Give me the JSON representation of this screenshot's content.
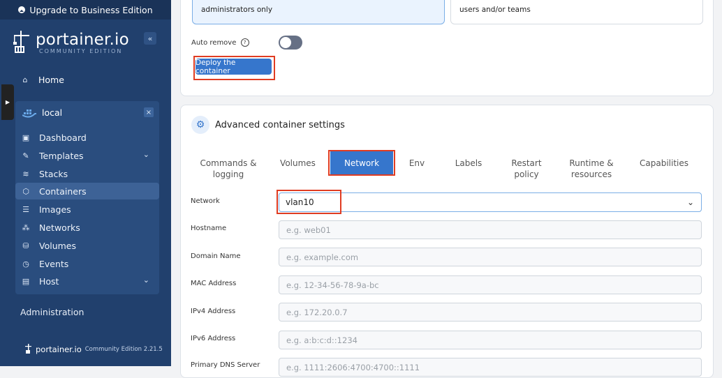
{
  "sidebar": {
    "upgrade_label": "Upgrade to Business Edition",
    "logo_text": "portainer.io",
    "logo_subtitle": "COMMUNITY EDITION",
    "collapse_label": "«",
    "home_label": "Home",
    "environment": {
      "name": "local",
      "close_label": "×",
      "items": [
        {
          "label": "Dashboard",
          "icon": "dashboard-icon"
        },
        {
          "label": "Templates",
          "icon": "templates-icon",
          "expandable": true
        },
        {
          "label": "Stacks",
          "icon": "stacks-icon"
        },
        {
          "label": "Containers",
          "icon": "containers-icon",
          "active": true
        },
        {
          "label": "Images",
          "icon": "images-icon"
        },
        {
          "label": "Networks",
          "icon": "networks-icon"
        },
        {
          "label": "Volumes",
          "icon": "volumes-icon"
        },
        {
          "label": "Events",
          "icon": "events-icon"
        },
        {
          "label": "Host",
          "icon": "host-icon",
          "expandable": true
        }
      ]
    },
    "administration_label": "Administration",
    "footer": {
      "brand": "portainer.io",
      "edition": "Community Edition 2.21.5"
    }
  },
  "access": {
    "admins_text": "administrators only",
    "teams_text": "users and/or teams"
  },
  "auto_remove": {
    "label": "Auto remove",
    "help_icon": "?",
    "enabled": false
  },
  "deploy_button_label": "Deploy the container",
  "advanced": {
    "title": "Advanced container settings",
    "tabs": [
      {
        "label": "Commands & logging"
      },
      {
        "label": "Volumes"
      },
      {
        "label": "Network",
        "active": true
      },
      {
        "label": "Env"
      },
      {
        "label": "Labels"
      },
      {
        "label": "Restart policy"
      },
      {
        "label": "Runtime & resources"
      },
      {
        "label": "Capabilities"
      }
    ],
    "fields": {
      "network": {
        "label": "Network",
        "value": "vlan10"
      },
      "hostname": {
        "label": "Hostname",
        "placeholder": "e.g. web01"
      },
      "domain": {
        "label": "Domain Name",
        "placeholder": "e.g. example.com"
      },
      "mac": {
        "label": "MAC Address",
        "placeholder": "e.g. 12-34-56-78-9a-bc"
      },
      "ipv4": {
        "label": "IPv4 Address",
        "placeholder": "e.g. 172.20.0.7"
      },
      "ipv6": {
        "label": "IPv6 Address",
        "placeholder": "e.g. a:b:c:d::1234"
      },
      "dns": {
        "label": "Primary DNS Server",
        "placeholder": "e.g. 1111:2606:4700:4700::1111"
      }
    }
  },
  "colors": {
    "sidebar_bg": "#21406d",
    "accent": "#3676cc",
    "highlight_box": "#e03c22"
  }
}
